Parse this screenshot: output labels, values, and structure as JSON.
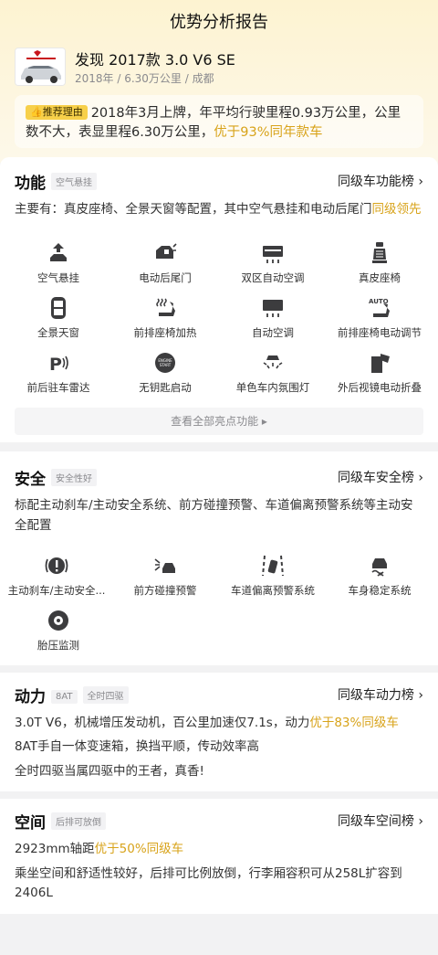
{
  "header": {
    "title": "优势分析报告"
  },
  "car": {
    "name": "发现 2017款 3.0 V6 SE",
    "meta": "2018年 / 6.30万公里 / 成都"
  },
  "recommend": {
    "badge": "推荐理由",
    "text": "2018年3月上牌，年平均行驶里程0.93万公里，公里数不大，表显里程6.30万公里，",
    "highlight": "优于93%同年款车"
  },
  "features": {
    "title": "功能",
    "tag": "空气悬挂",
    "rank_link": "同级车功能榜 ›",
    "desc": "主要有：真皮座椅、全景天窗等配置，其中空气悬挂和电动后尾门",
    "desc_highlight": "同级领先",
    "items": [
      {
        "label": "空气悬挂",
        "icon": "air-suspension-icon"
      },
      {
        "label": "电动后尾门",
        "icon": "power-tailgate-icon"
      },
      {
        "label": "双区自动空调",
        "icon": "dual-zone-ac-icon"
      },
      {
        "label": "真皮座椅",
        "icon": "leather-seat-icon"
      },
      {
        "label": "全景天窗",
        "icon": "panoramic-sunroof-icon"
      },
      {
        "label": "前排座椅加热",
        "icon": "seat-heating-icon"
      },
      {
        "label": "自动空调",
        "icon": "auto-ac-icon"
      },
      {
        "label": "前排座椅电动调节",
        "icon": "power-seat-icon"
      },
      {
        "label": "前后驻车雷达",
        "icon": "parking-radar-icon"
      },
      {
        "label": "无钥匙启动",
        "icon": "keyless-start-icon"
      },
      {
        "label": "单色车内氛围灯",
        "icon": "ambient-light-icon"
      },
      {
        "label": "外后视镜电动折叠",
        "icon": "mirror-fold-icon"
      }
    ],
    "more": "查看全部亮点功能 ▸"
  },
  "safety": {
    "title": "安全",
    "tag": "安全性好",
    "rank_link": "同级车安全榜 ›",
    "desc": "标配主动刹车/主动安全系统、前方碰撞预警、车道偏离预警系统等主动安全配置",
    "items": [
      {
        "label": "主动刹车/主动安全...",
        "icon": "active-brake-icon"
      },
      {
        "label": "前方碰撞预警",
        "icon": "collision-warning-icon"
      },
      {
        "label": "车道偏离预警系统",
        "icon": "lane-departure-icon"
      },
      {
        "label": "车身稳定系统",
        "icon": "stability-control-icon"
      },
      {
        "label": "胎压监测",
        "icon": "tire-pressure-icon"
      }
    ]
  },
  "power": {
    "title": "动力",
    "tags": [
      "8AT",
      "全时四驱"
    ],
    "rank_link": "同级车动力榜 ›",
    "line1": "3.0T V6，机械增压发动机，百公里加速仅7.1s，动力",
    "line1_highlight": "优于83%同级车",
    "line2": "8AT手自一体变速箱，换挡平顺，传动效率高",
    "line3": "全时四驱当属四驱中的王者，真香!"
  },
  "space": {
    "title": "空间",
    "tag": "后排可放倒",
    "rank_link": "同级车空间榜 ›",
    "line1": "2923mm轴距",
    "line1_highlight": "优于50%同级车",
    "line2": "乘坐空间和舒适性较好，后排可比例放倒，行李厢容积可从258L扩容到2406L"
  },
  "colors": {
    "accent": "#d8a31a",
    "badge": "#f7d04a",
    "icon": "#3c3c3e"
  }
}
